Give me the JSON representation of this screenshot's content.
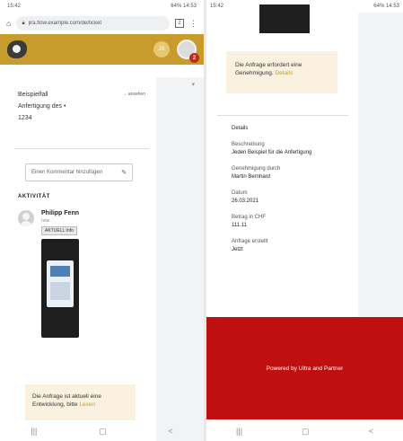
{
  "left": {
    "status": {
      "time": "15:42",
      "right": "64% 14:53"
    },
    "browser": {
      "url": "jira.flow.example.com/de/ticket",
      "tab_count": "2"
    },
    "appbar": {
      "user_initials": "JS",
      "notification_count": "2"
    },
    "meta": [
      {
        "label": "Beispielfall",
        "right": "→ ansehen"
      },
      {
        "label": "Anfertigung des •"
      },
      {
        "label": "1234"
      }
    ],
    "comment_placeholder": "Einen Kommentar hinzufügen",
    "section_title": "AKTIVITÄT",
    "activity": {
      "name": "Philipp Fenn",
      "sub": "now",
      "tag": "AKTUELL Info"
    },
    "notice": {
      "text": "Die Anfrage ist aktuell eine Entwicklung, bitte",
      "link": "Lesen"
    },
    "nav": [
      "|||",
      "▢",
      "<"
    ]
  },
  "right": {
    "status": {
      "time": "15:42",
      "right": "64% 14:53"
    },
    "notice": {
      "text": "Die Anfrage erfordert eine Genehmigung.",
      "link": "Details"
    },
    "details_title": "Details",
    "fields": [
      {
        "label": "Beschreibung",
        "value": "Jeden Beispiel für die Anfertigung"
      },
      {
        "label": "Genehmigung durch",
        "value": "Martin Bernhard"
      },
      {
        "label": "Datum",
        "value": "26.03.2021"
      },
      {
        "label": "Betrag in CHF",
        "value": "111.11"
      },
      {
        "label": "Anfrage erstellt",
        "value": "Jetzt"
      }
    ],
    "footer": "Powered by Ultra and Partner",
    "nav": [
      "|||",
      "▢",
      "<"
    ]
  }
}
